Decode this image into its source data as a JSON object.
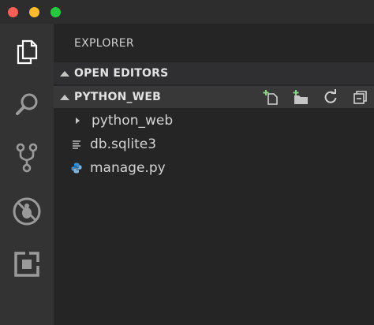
{
  "window": {
    "controls": [
      "close",
      "minimize",
      "maximize"
    ]
  },
  "activity_bar": {
    "items": [
      {
        "icon": "files-icon",
        "active": true
      },
      {
        "icon": "search-icon",
        "active": false
      },
      {
        "icon": "source-control-icon",
        "active": false
      },
      {
        "icon": "debug-icon",
        "active": false
      },
      {
        "icon": "extensions-icon",
        "active": false
      }
    ]
  },
  "explorer": {
    "title": "EXPLORER",
    "open_editors_label": "OPEN EDITORS",
    "project_label": "PYTHON_WEB",
    "toolbar": [
      "new-file-icon",
      "new-folder-icon",
      "refresh-icon",
      "collapse-all-icon"
    ],
    "items": [
      {
        "name": "python_web",
        "type": "folder",
        "icon": "chevron-right-icon"
      },
      {
        "name": "db.sqlite3",
        "type": "file",
        "icon": "file-lines-icon"
      },
      {
        "name": "manage.py",
        "type": "file",
        "icon": "python-icon"
      }
    ]
  },
  "colors": {
    "activity_bg": "#333333",
    "sidebar_bg": "#252526",
    "accent_green": "#89d185",
    "python_blue": "#3b8ed0"
  }
}
